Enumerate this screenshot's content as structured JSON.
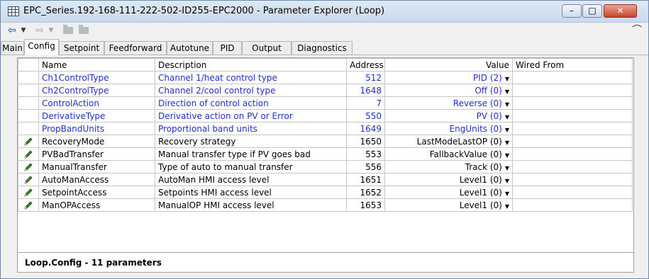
{
  "window": {
    "title": "EPC_Series.192-168-111-222-502-ID255-EPC2000 - Parameter Explorer (Loop)",
    "minimize_glyph": "–",
    "maximize_glyph": "□",
    "close_glyph": "✕"
  },
  "toolbar": {
    "back_glyph": "⇦",
    "dropdown_glyph": "▼",
    "forward_glyph": "⇨",
    "pin_glyph": "⌒"
  },
  "tabs": [
    {
      "label": "Main",
      "active": false
    },
    {
      "label": "Config",
      "active": true
    },
    {
      "label": "Setpoint",
      "active": false
    },
    {
      "label": "Feedforward",
      "active": false
    },
    {
      "label": "Autotune",
      "active": false
    },
    {
      "label": "PID",
      "active": false
    },
    {
      "label": "Output",
      "active": false
    },
    {
      "label": "Diagnostics",
      "active": false
    }
  ],
  "table": {
    "columns": [
      "Name",
      "Description",
      "Address",
      "Value",
      "Wired From"
    ],
    "rows": [
      {
        "editable": false,
        "name": "Ch1ControlType",
        "description": "Channel 1/heat control type",
        "address": "512",
        "value": "PID (2)",
        "wired_from": ""
      },
      {
        "editable": false,
        "name": "Ch2ControlType",
        "description": "Channel 2/cool control type",
        "address": "1648",
        "value": "Off (0)",
        "wired_from": ""
      },
      {
        "editable": false,
        "name": "ControlAction",
        "description": "Direction of control action",
        "address": "7",
        "value": "Reverse (0)",
        "wired_from": ""
      },
      {
        "editable": false,
        "name": "DerivativeType",
        "description": "Derivative action on PV or Error",
        "address": "550",
        "value": "PV (0)",
        "wired_from": ""
      },
      {
        "editable": false,
        "name": "PropBandUnits",
        "description": "Proportional band units",
        "address": "1649",
        "value": "EngUnits (0)",
        "wired_from": ""
      },
      {
        "editable": true,
        "name": "RecoveryMode",
        "description": "Recovery strategy",
        "address": "1650",
        "value": "LastModeLastOP (0)",
        "wired_from": ""
      },
      {
        "editable": true,
        "name": "PVBadTransfer",
        "description": "Manual transfer type if PV goes bad",
        "address": "553",
        "value": "FallbackValue (0)",
        "wired_from": ""
      },
      {
        "editable": true,
        "name": "ManualTransfer",
        "description": "Type of auto to manual transfer",
        "address": "556",
        "value": "Track (0)",
        "wired_from": ""
      },
      {
        "editable": true,
        "name": "AutoManAccess",
        "description": "AutoMan HMI access level",
        "address": "1651",
        "value": "Level1 (0)",
        "wired_from": ""
      },
      {
        "editable": true,
        "name": "SetpointAccess",
        "description": "Setpoints HMI access level",
        "address": "1652",
        "value": "Level1 (0)",
        "wired_from": ""
      },
      {
        "editable": true,
        "name": "ManOPAccess",
        "description": "ManualOP HMI access level",
        "address": "1653",
        "value": "Level1 (0)",
        "wired_from": ""
      }
    ]
  },
  "status": {
    "text": "Loop.Config  -  11 parameters"
  },
  "colors": {
    "readonly_text": "#1f2fd1",
    "editable_text": "#000000",
    "pencil": "#3a8a2e"
  },
  "icons": {
    "app": "grid-window-icon",
    "row_edit": "pencil-icon"
  }
}
